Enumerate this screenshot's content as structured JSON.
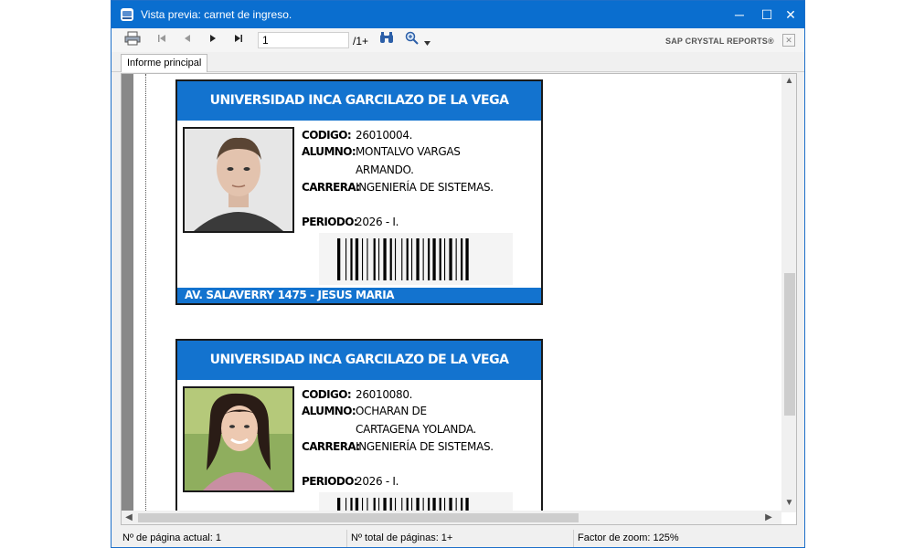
{
  "window": {
    "title": "Vista previa: carnet de ingreso.",
    "minimize_glyph": "─",
    "maximize_glyph": "☐",
    "close_glyph": "✕"
  },
  "toolbar": {
    "print_icon": "printer-icon",
    "first_icon": "first-page-icon",
    "prev_icon": "prev-page-icon",
    "next_icon": "next-page-icon",
    "last_icon": "last-page-icon",
    "page_value": "1",
    "page_total": "/1+",
    "find_icon": "binoculars-icon",
    "zoom_icon": "zoom-icon",
    "brand": "SAP CRYSTAL REPORTS®"
  },
  "tabs": [
    {
      "label": "Informe principal"
    }
  ],
  "cards": [
    {
      "header": "UNIVERSIDAD INCA GARCILAZO DE LA VEGA",
      "codigo_label": "CODIGO:",
      "codigo": "26010004.",
      "alumno_label": "ALUMNO:",
      "alumno_line1": "MONTALVO VARGAS",
      "alumno_line2": "ARMANDO.",
      "carrera_label": "CARRERA:",
      "carrera": "INGENIERÍA DE SISTEMAS.",
      "periodo_label": "PERIODO:",
      "periodo": "2026 - I.",
      "footer": "AV. SALAVERRY 1475 - JESUS MARIA"
    },
    {
      "header": "UNIVERSIDAD INCA GARCILAZO DE LA VEGA",
      "codigo_label": "CODIGO:",
      "codigo": "26010080.",
      "alumno_label": "ALUMNO:",
      "alumno_line1": "OCHARAN DE",
      "alumno_line2": "CARTAGENA YOLANDA.",
      "carrera_label": "CARRERA:",
      "carrera": "INGENIERÍA DE SISTEMAS.",
      "periodo_label": "PERIODO:",
      "periodo": "2026 - I."
    }
  ],
  "status": {
    "current_page": "Nº de página actual: 1",
    "total_pages": "Nº total de páginas: 1+",
    "zoom": "Factor de zoom: 125%"
  },
  "colors": {
    "titlebar": "#0a6ecf",
    "card_accent": "#1373cf"
  }
}
